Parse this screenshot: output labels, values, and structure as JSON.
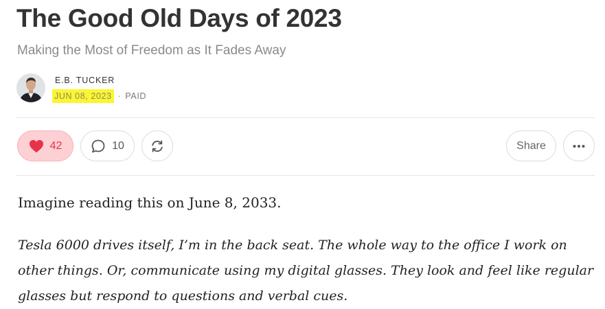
{
  "post": {
    "title": "The Good Old Days of 2023",
    "subtitle": "Making the Most of Freedom as It Fades Away"
  },
  "author": {
    "name": "E.B. TUCKER",
    "date": "JUN 08, 2023",
    "separator": "·",
    "access": "PAID"
  },
  "actions": {
    "like_count": "42",
    "comment_count": "10",
    "share_label": "Share",
    "icons": {
      "like": "heart-icon",
      "comment": "speech-bubble-icon",
      "restack": "restack-icon",
      "more": "ellipsis-icon"
    },
    "like_color": "#e8324a",
    "like_bg": "#fdd0d4"
  },
  "highlight_color": "#fbf532",
  "body": {
    "paragraphs": [
      "Imagine reading this on June 8, 2033.",
      "Tesla 6000 drives itself, I’m in the back seat. The whole way to the office I work on other things. Or, communicate using my digital glasses. They look and feel like regular glasses but respond to questions and verbal cues."
    ]
  }
}
